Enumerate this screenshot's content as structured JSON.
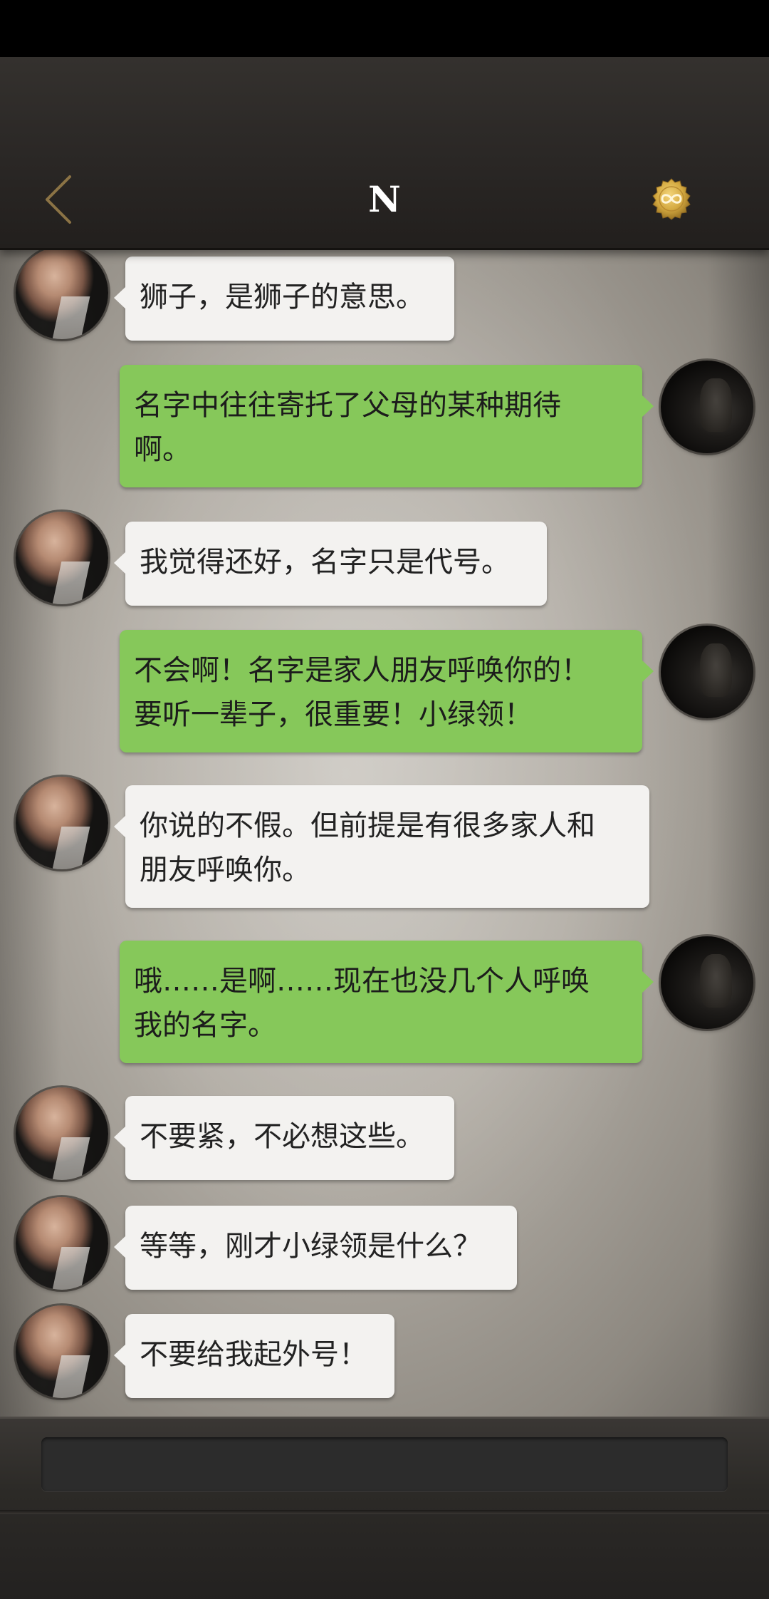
{
  "header": {
    "title": "N",
    "back_icon": "chevron-left-icon",
    "badge_icon": "infinity-seal-icon",
    "accent_color": "#8b7345",
    "badge_color": "#d4a940"
  },
  "colors": {
    "incoming_bubble": "#f3f2f0",
    "outgoing_bubble": "#86c85a"
  },
  "messages": [
    {
      "side": "other",
      "text": "狮子，是狮子的意思。"
    },
    {
      "side": "self",
      "line1": "名字中往往寄托了父母的某种期待",
      "line2": "啊。"
    },
    {
      "side": "other",
      "text": "我觉得还好，名字只是代号。"
    },
    {
      "side": "self",
      "line1": "不会啊！名字是家人朋友呼唤你的！",
      "line2": "要听一辈子，很重要！小绿领！"
    },
    {
      "side": "other",
      "line1": "你说的不假。但前提是有很多家人和",
      "line2": "朋友呼唤你。"
    },
    {
      "side": "self",
      "line1": "哦……是啊……现在也没几个人呼唤",
      "line2": "我的名字。"
    },
    {
      "side": "other",
      "text": "不要紧，不必想这些。"
    },
    {
      "side": "other",
      "text": "等等，刚才小绿领是什么？"
    },
    {
      "side": "other",
      "text": "不要给我起外号！"
    }
  ],
  "input": {
    "placeholder": "",
    "value": ""
  }
}
